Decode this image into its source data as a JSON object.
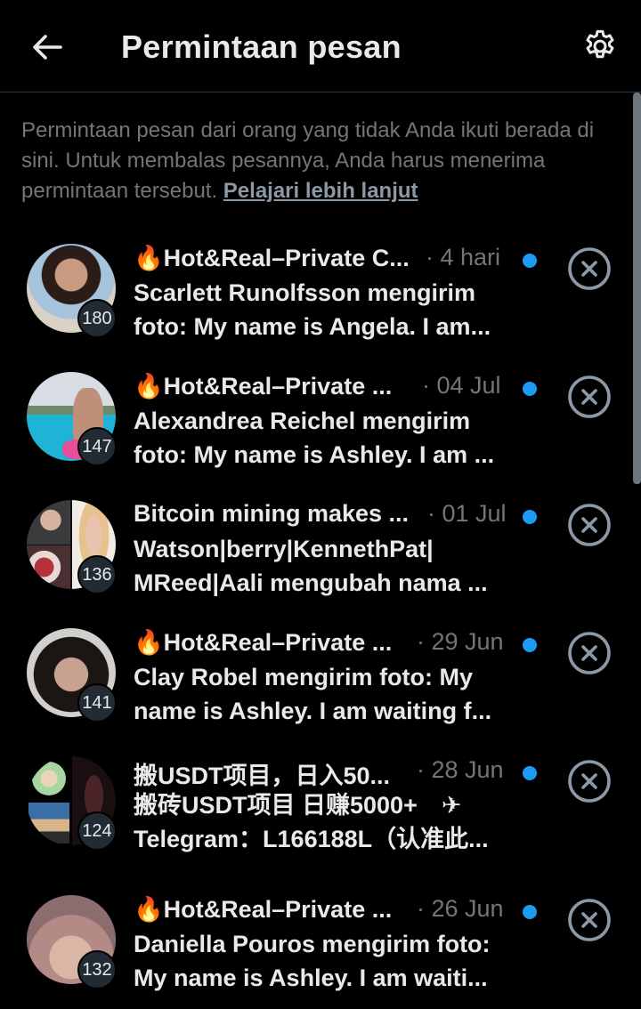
{
  "header": {
    "title": "Permintaan pesan",
    "back_icon": "arrow-left-icon",
    "settings_icon": "gear-icon"
  },
  "intro": {
    "text": "Permintaan pesan dari orang yang tidak Anda ikuti berada di sini. Untuk membalas pesannya, Anda harus menerima permintaan tersebut.",
    "link": "Pelajari lebih lanjut"
  },
  "colors": {
    "accent": "#1d9bf0",
    "muted": "#71767b",
    "text": "#e7e9ea"
  },
  "requests": [
    {
      "name": "🔥Hot&Real–Private C...",
      "time": "· 4 hari",
      "badge": "180",
      "line1": "Scarlett Runolfsson mengirim",
      "line2": "foto: My name is Angela. I am..."
    },
    {
      "name": "🔥Hot&Real–Private ...",
      "time": "· 04 Jul",
      "badge": "147",
      "line1": "Alexandrea Reichel mengirim",
      "line2": "foto: My name is Ashley. I am ..."
    },
    {
      "name": "Bitcoin mining makes ...",
      "time": "· 01 Jul",
      "badge": "136",
      "line1": "Watson|berry|KennethPat|",
      "line2": "MReed|Aali mengubah nama ..."
    },
    {
      "name": "🔥Hot&Real–Private ...",
      "time": "· 29 Jun",
      "badge": "141",
      "line1": "Clay Robel mengirim foto: My",
      "line2": "name is Ashley. I am waiting f..."
    },
    {
      "name": "搬USDT项目，日入50...",
      "time": "· 28 Jun",
      "badge": "124",
      "line1": "搬砖USDT项目 日赚5000+　✈",
      "line2": "Telegram：L166188L（认准此..."
    },
    {
      "name": "🔥Hot&Real–Private ...",
      "time": "· 26 Jun",
      "badge": "132",
      "line1": "Daniella Pouros mengirim foto:",
      "line2": "My name is Ashley. I am waiti..."
    }
  ]
}
